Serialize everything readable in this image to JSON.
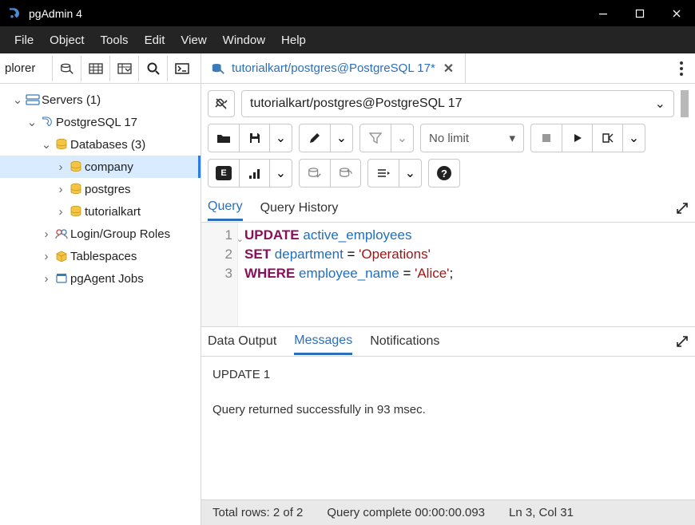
{
  "window": {
    "title": "pgAdmin 4"
  },
  "menubar": [
    "File",
    "Object",
    "Tools",
    "Edit",
    "View",
    "Window",
    "Help"
  ],
  "sidebar": {
    "title": "plorer",
    "tree": {
      "servers": "Servers (1)",
      "pg17": "PostgreSQL 17",
      "databases": "Databases (3)",
      "db_company": "company",
      "db_postgres": "postgres",
      "db_tutorialkart": "tutorialkart",
      "login_roles": "Login/Group Roles",
      "tablespaces": "Tablespaces",
      "pgagent": "pgAgent Jobs"
    }
  },
  "tab": {
    "label": "tutorialkart/postgres@PostgreSQL 17*"
  },
  "connection": {
    "label": "tutorialkart/postgres@PostgreSQL 17"
  },
  "limit": {
    "label": "No limit"
  },
  "query_tabs": {
    "query": "Query",
    "history": "Query History"
  },
  "sql": {
    "l1_kw": "UPDATE",
    "l1_ident": "active_employees",
    "l2_kw": "SET",
    "l2_ident": "department",
    "l2_eq": " = ",
    "l2_str": "'Operations'",
    "l3_kw": "WHERE",
    "l3_ident": "employee_name",
    "l3_eq": " = ",
    "l3_str": "'Alice'",
    "l3_semi": ";"
  },
  "output_tabs": {
    "data": "Data Output",
    "messages": "Messages",
    "notifications": "Notifications"
  },
  "messages": {
    "line1": "UPDATE 1",
    "line2": "Query returned successfully in 93 msec."
  },
  "status": {
    "rows": "Total rows: 2 of 2",
    "complete": "Query complete 00:00:00.093",
    "cursor": "Ln 3, Col 31"
  }
}
